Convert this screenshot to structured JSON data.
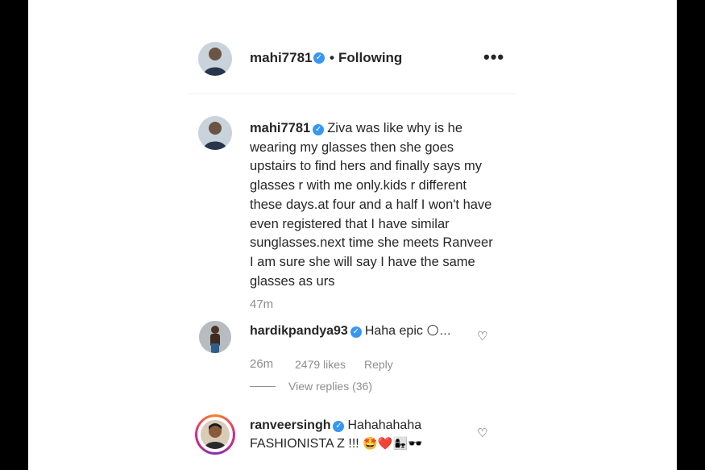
{
  "header": {
    "username": "mahi7781",
    "separator": "•",
    "follow_status": "Following",
    "more_icon": "more-horizontal-icon"
  },
  "caption": {
    "username": "mahi7781",
    "text": "Ziva was like why is he wearing my glasses then she goes upstairs to find hers and finally says my glasses r with me only.kids r different these days.at four and a half I won't have even registered that I have similar sunglasses.next time she meets Ranveer I am sure she will say I have the same glasses as urs",
    "time": "47m"
  },
  "comments": [
    {
      "username": "hardikpandya93",
      "text": "Haha epic",
      "emoji": "🌕…",
      "time": "26m",
      "likes": "2479 likes",
      "reply": "Reply",
      "view_replies": "View replies (36)"
    },
    {
      "username": "ranveersingh",
      "text": "Hahahahaha FASHIONISTA Z !!!",
      "emoji": "🤩❤️👩‍👧🕶️"
    }
  ],
  "colors": {
    "verified": "#3897f0",
    "meta_gray": "#8e8e8e",
    "story_ring": "#dd2a7b"
  }
}
